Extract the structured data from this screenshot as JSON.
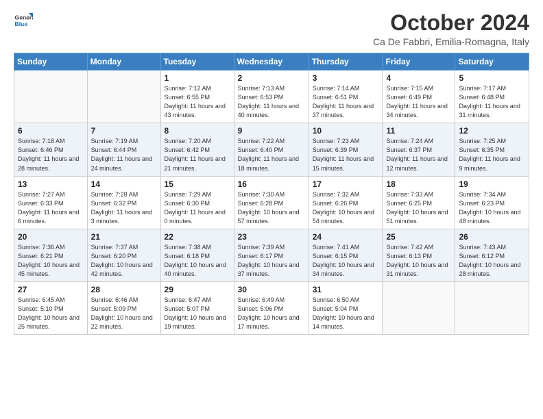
{
  "header": {
    "logo_line1": "General",
    "logo_line2": "Blue",
    "month": "October 2024",
    "location": "Ca De Fabbri, Emilia-Romagna, Italy"
  },
  "weekdays": [
    "Sunday",
    "Monday",
    "Tuesday",
    "Wednesday",
    "Thursday",
    "Friday",
    "Saturday"
  ],
  "weeks": [
    [
      {
        "day": "",
        "sunrise": "",
        "sunset": "",
        "daylight": ""
      },
      {
        "day": "",
        "sunrise": "",
        "sunset": "",
        "daylight": ""
      },
      {
        "day": "1",
        "sunrise": "Sunrise: 7:12 AM",
        "sunset": "Sunset: 6:55 PM",
        "daylight": "Daylight: 11 hours and 43 minutes."
      },
      {
        "day": "2",
        "sunrise": "Sunrise: 7:13 AM",
        "sunset": "Sunset: 6:53 PM",
        "daylight": "Daylight: 11 hours and 40 minutes."
      },
      {
        "day": "3",
        "sunrise": "Sunrise: 7:14 AM",
        "sunset": "Sunset: 6:51 PM",
        "daylight": "Daylight: 11 hours and 37 minutes."
      },
      {
        "day": "4",
        "sunrise": "Sunrise: 7:15 AM",
        "sunset": "Sunset: 6:49 PM",
        "daylight": "Daylight: 11 hours and 34 minutes."
      },
      {
        "day": "5",
        "sunrise": "Sunrise: 7:17 AM",
        "sunset": "Sunset: 6:48 PM",
        "daylight": "Daylight: 11 hours and 31 minutes."
      }
    ],
    [
      {
        "day": "6",
        "sunrise": "Sunrise: 7:18 AM",
        "sunset": "Sunset: 6:46 PM",
        "daylight": "Daylight: 11 hours and 28 minutes."
      },
      {
        "day": "7",
        "sunrise": "Sunrise: 7:19 AM",
        "sunset": "Sunset: 6:44 PM",
        "daylight": "Daylight: 11 hours and 24 minutes."
      },
      {
        "day": "8",
        "sunrise": "Sunrise: 7:20 AM",
        "sunset": "Sunset: 6:42 PM",
        "daylight": "Daylight: 11 hours and 21 minutes."
      },
      {
        "day": "9",
        "sunrise": "Sunrise: 7:22 AM",
        "sunset": "Sunset: 6:40 PM",
        "daylight": "Daylight: 11 hours and 18 minutes."
      },
      {
        "day": "10",
        "sunrise": "Sunrise: 7:23 AM",
        "sunset": "Sunset: 6:39 PM",
        "daylight": "Daylight: 11 hours and 15 minutes."
      },
      {
        "day": "11",
        "sunrise": "Sunrise: 7:24 AM",
        "sunset": "Sunset: 6:37 PM",
        "daylight": "Daylight: 11 hours and 12 minutes."
      },
      {
        "day": "12",
        "sunrise": "Sunrise: 7:25 AM",
        "sunset": "Sunset: 6:35 PM",
        "daylight": "Daylight: 11 hours and 9 minutes."
      }
    ],
    [
      {
        "day": "13",
        "sunrise": "Sunrise: 7:27 AM",
        "sunset": "Sunset: 6:33 PM",
        "daylight": "Daylight: 11 hours and 6 minutes."
      },
      {
        "day": "14",
        "sunrise": "Sunrise: 7:28 AM",
        "sunset": "Sunset: 6:32 PM",
        "daylight": "Daylight: 11 hours and 3 minutes."
      },
      {
        "day": "15",
        "sunrise": "Sunrise: 7:29 AM",
        "sunset": "Sunset: 6:30 PM",
        "daylight": "Daylight: 11 hours and 0 minutes."
      },
      {
        "day": "16",
        "sunrise": "Sunrise: 7:30 AM",
        "sunset": "Sunset: 6:28 PM",
        "daylight": "Daylight: 10 hours and 57 minutes."
      },
      {
        "day": "17",
        "sunrise": "Sunrise: 7:32 AM",
        "sunset": "Sunset: 6:26 PM",
        "daylight": "Daylight: 10 hours and 54 minutes."
      },
      {
        "day": "18",
        "sunrise": "Sunrise: 7:33 AM",
        "sunset": "Sunset: 6:25 PM",
        "daylight": "Daylight: 10 hours and 51 minutes."
      },
      {
        "day": "19",
        "sunrise": "Sunrise: 7:34 AM",
        "sunset": "Sunset: 6:23 PM",
        "daylight": "Daylight: 10 hours and 48 minutes."
      }
    ],
    [
      {
        "day": "20",
        "sunrise": "Sunrise: 7:36 AM",
        "sunset": "Sunset: 6:21 PM",
        "daylight": "Daylight: 10 hours and 45 minutes."
      },
      {
        "day": "21",
        "sunrise": "Sunrise: 7:37 AM",
        "sunset": "Sunset: 6:20 PM",
        "daylight": "Daylight: 10 hours and 42 minutes."
      },
      {
        "day": "22",
        "sunrise": "Sunrise: 7:38 AM",
        "sunset": "Sunset: 6:18 PM",
        "daylight": "Daylight: 10 hours and 40 minutes."
      },
      {
        "day": "23",
        "sunrise": "Sunrise: 7:39 AM",
        "sunset": "Sunset: 6:17 PM",
        "daylight": "Daylight: 10 hours and 37 minutes."
      },
      {
        "day": "24",
        "sunrise": "Sunrise: 7:41 AM",
        "sunset": "Sunset: 6:15 PM",
        "daylight": "Daylight: 10 hours and 34 minutes."
      },
      {
        "day": "25",
        "sunrise": "Sunrise: 7:42 AM",
        "sunset": "Sunset: 6:13 PM",
        "daylight": "Daylight: 10 hours and 31 minutes."
      },
      {
        "day": "26",
        "sunrise": "Sunrise: 7:43 AM",
        "sunset": "Sunset: 6:12 PM",
        "daylight": "Daylight: 10 hours and 28 minutes."
      }
    ],
    [
      {
        "day": "27",
        "sunrise": "Sunrise: 6:45 AM",
        "sunset": "Sunset: 5:10 PM",
        "daylight": "Daylight: 10 hours and 25 minutes."
      },
      {
        "day": "28",
        "sunrise": "Sunrise: 6:46 AM",
        "sunset": "Sunset: 5:09 PM",
        "daylight": "Daylight: 10 hours and 22 minutes."
      },
      {
        "day": "29",
        "sunrise": "Sunrise: 6:47 AM",
        "sunset": "Sunset: 5:07 PM",
        "daylight": "Daylight: 10 hours and 19 minutes."
      },
      {
        "day": "30",
        "sunrise": "Sunrise: 6:49 AM",
        "sunset": "Sunset: 5:06 PM",
        "daylight": "Daylight: 10 hours and 17 minutes."
      },
      {
        "day": "31",
        "sunrise": "Sunrise: 6:50 AM",
        "sunset": "Sunset: 5:04 PM",
        "daylight": "Daylight: 10 hours and 14 minutes."
      },
      {
        "day": "",
        "sunrise": "",
        "sunset": "",
        "daylight": ""
      },
      {
        "day": "",
        "sunrise": "",
        "sunset": "",
        "daylight": ""
      }
    ]
  ]
}
